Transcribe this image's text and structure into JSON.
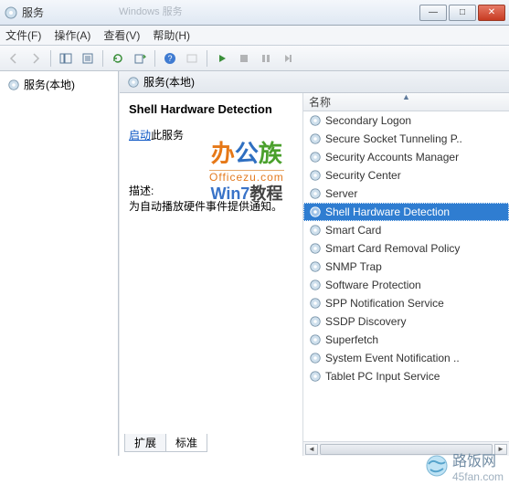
{
  "window": {
    "title": "服务",
    "ghost_title": "Windows 服务",
    "buttons": {
      "min": "—",
      "max": "□",
      "close": "✕"
    }
  },
  "menu": {
    "file": "文件(F)",
    "action": "操作(A)",
    "view": "查看(V)",
    "help": "帮助(H)"
  },
  "left_tree": {
    "root": "服务(本地)"
  },
  "right_header": "服务(本地)",
  "detail": {
    "service_name": "Shell Hardware Detection",
    "start_link": "启动",
    "start_suffix": "此服务",
    "desc_label": "描述:",
    "desc_text": "为自动播放硬件事件提供通知。"
  },
  "watermark": {
    "logo_c1": "办",
    "logo_c2": "公",
    "logo_c3": "族",
    "officezu": "Officezu.com",
    "win7_w": "Win7",
    "win7_t": "教程"
  },
  "list": {
    "header": "名称",
    "items": [
      {
        "label": "Secondary Logon",
        "selected": false
      },
      {
        "label": "Secure Socket Tunneling P..",
        "selected": false
      },
      {
        "label": "Security Accounts Manager",
        "selected": false
      },
      {
        "label": "Security Center",
        "selected": false
      },
      {
        "label": "Server",
        "selected": false
      },
      {
        "label": "Shell Hardware Detection",
        "selected": true
      },
      {
        "label": "Smart Card",
        "selected": false
      },
      {
        "label": "Smart Card Removal Policy",
        "selected": false
      },
      {
        "label": "SNMP Trap",
        "selected": false
      },
      {
        "label": "Software Protection",
        "selected": false
      },
      {
        "label": "SPP Notification Service",
        "selected": false
      },
      {
        "label": "SSDP Discovery",
        "selected": false
      },
      {
        "label": "Superfetch",
        "selected": false
      },
      {
        "label": "System Event Notification ..",
        "selected": false
      },
      {
        "label": "Tablet PC Input Service",
        "selected": false
      }
    ]
  },
  "tabs": {
    "extended": "扩展",
    "standard": "标准"
  },
  "footer": {
    "brand": "路饭网",
    "domain": "45fan.com"
  }
}
